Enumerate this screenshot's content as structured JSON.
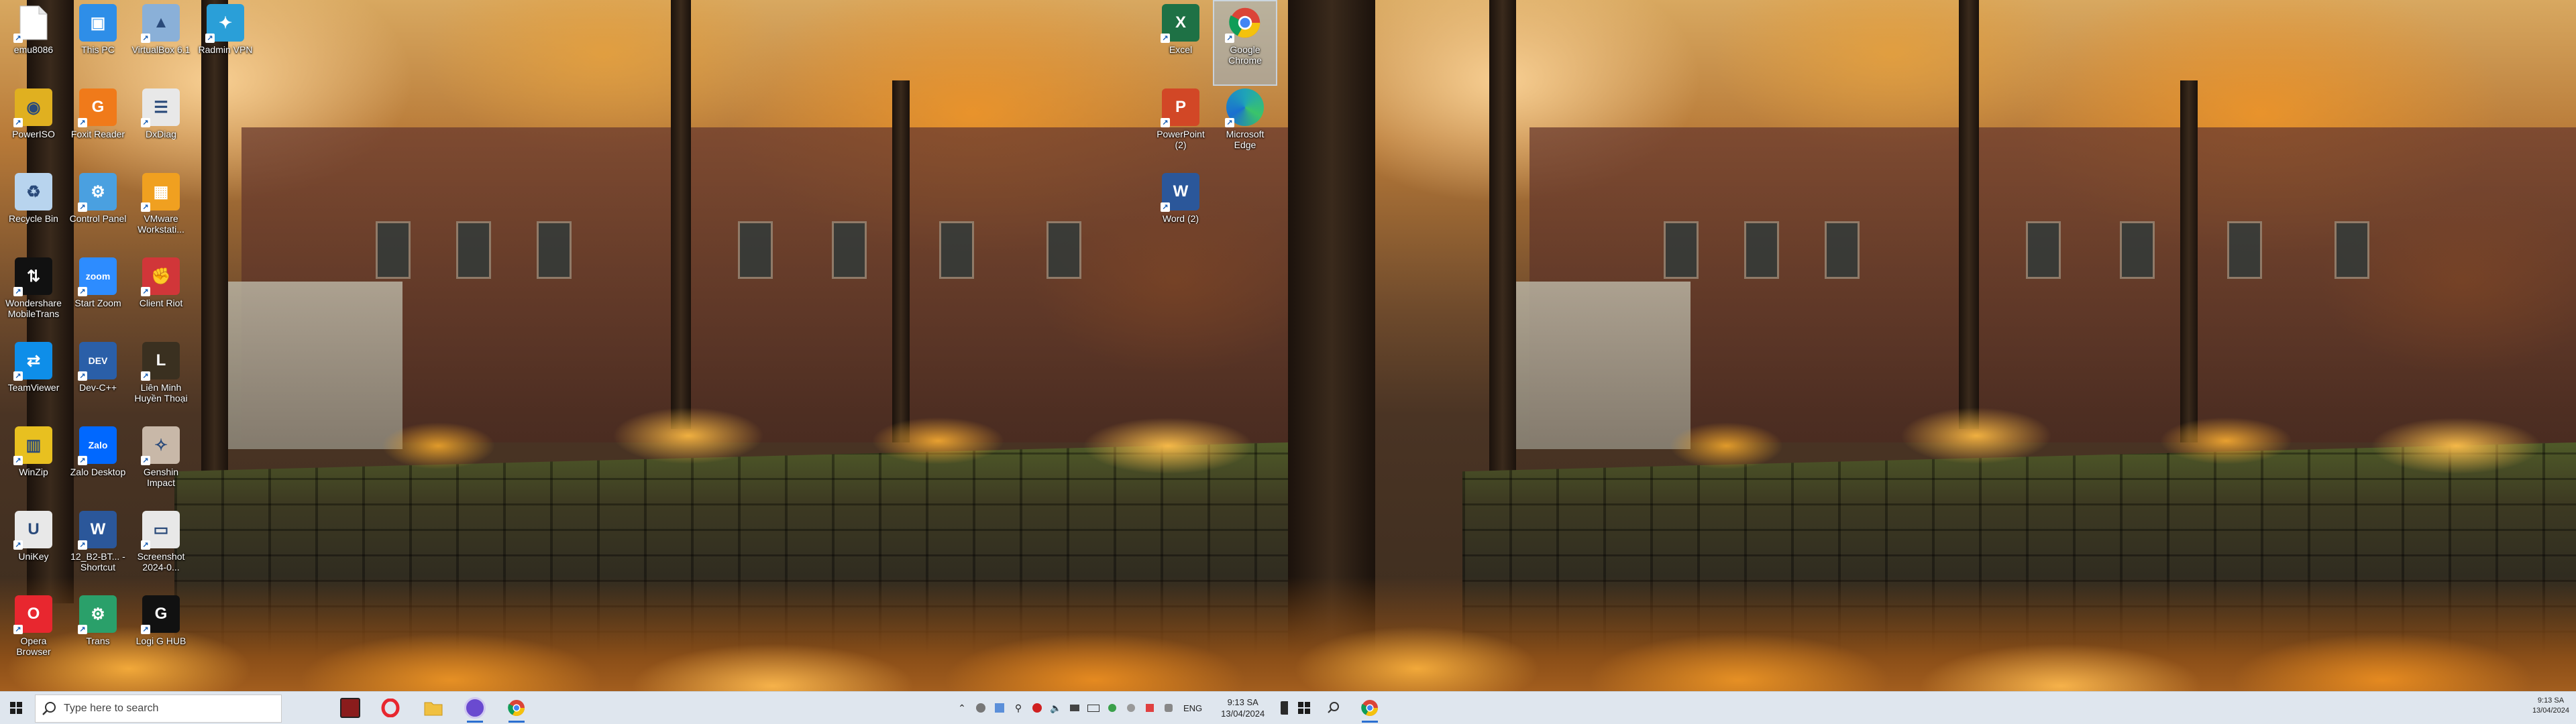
{
  "left_monitor": {
    "desktop_icons": [
      {
        "label": "emu8086",
        "icon": "file-icon",
        "color": "#ffffff"
      },
      {
        "label": "This PC",
        "icon": "computer-icon",
        "color": "#2e8ee8"
      },
      {
        "label": "VirtualBox 6.1",
        "icon": "virtualbox-icon",
        "color": "#8ab0d8"
      },
      {
        "label": "Radmin VPN",
        "icon": "radmin-vpn-icon",
        "color": "#2a9fd8"
      },
      {
        "label": "PowerISO",
        "icon": "poweriso-icon",
        "color": "#e0b020"
      },
      {
        "label": "Foxit Reader",
        "icon": "foxit-icon",
        "color": "#f07a1a"
      },
      {
        "label": "DxDiag",
        "icon": "dxdiag-icon",
        "color": "#e8e8e8"
      },
      {
        "label": "Recycle Bin",
        "icon": "recycle-bin-icon",
        "color": "#b8d4ee"
      },
      {
        "label": "Control Panel",
        "icon": "control-panel-icon",
        "color": "#4aa0e0"
      },
      {
        "label": "VMware Workstati...",
        "icon": "vmware-icon",
        "color": "#f0a020"
      },
      {
        "label": "Wondershare MobileTrans",
        "icon": "mobiletrans-icon",
        "color": "#111111"
      },
      {
        "label": "Start Zoom",
        "icon": "zoom-icon",
        "color": "#2d8cff"
      },
      {
        "label": "Client Riot",
        "icon": "riot-icon",
        "color": "#d13639"
      },
      {
        "label": "TeamViewer",
        "icon": "teamviewer-icon",
        "color": "#0e8ee9"
      },
      {
        "label": "Dev-C++",
        "icon": "devcpp-icon",
        "color": "#2a5fa8"
      },
      {
        "label": "Liên Minh Huyền Thoại",
        "icon": "league-icon",
        "color": "#3a3020"
      },
      {
        "label": "WinZip",
        "icon": "winzip-icon",
        "color": "#e8c020"
      },
      {
        "label": "Zalo Desktop",
        "icon": "zalo-icon",
        "color": "#0068ff"
      },
      {
        "label": "Genshin Impact",
        "icon": "genshin-icon",
        "color": "#c8b8a8"
      },
      {
        "label": "UniKey",
        "icon": "unikey-icon",
        "color": "#e8e8e8"
      },
      {
        "label": "12_B2-BT... - Shortcut",
        "icon": "word-doc-icon",
        "color": "#2b579a"
      },
      {
        "label": "Screenshot 2024-0...",
        "icon": "image-file-icon",
        "color": "#e8e8e8"
      },
      {
        "label": "Opera Browser",
        "icon": "opera-icon",
        "color": "#e8272f"
      },
      {
        "label": "Trans",
        "icon": "trans-icon",
        "color": "#2aa06a"
      },
      {
        "label": "Logi G HUB",
        "icon": "ghub-icon",
        "color": "#111111"
      },
      {
        "label": "Excel",
        "icon": "excel-icon",
        "color": "#1e7145"
      },
      {
        "label": "Google Chrome",
        "icon": "chrome-icon",
        "color": "#ffffff"
      },
      {
        "label": "PowerPoint (2)",
        "icon": "powerpoint-icon",
        "color": "#d24726"
      },
      {
        "label": "Microsoft Edge",
        "icon": "edge-icon",
        "color": "#1fa3b8"
      },
      {
        "label": "Word (2)",
        "icon": "word-icon",
        "color": "#2b579a"
      }
    ],
    "taskbar": {
      "search_placeholder": "Type here to search",
      "pinned_apps": [
        {
          "name": "app-icon-1",
          "color": "#8a1c1c"
        },
        {
          "name": "opera-taskbar-icon",
          "color": "#e8272f"
        },
        {
          "name": "file-explorer-icon",
          "color": "#f0c040"
        },
        {
          "name": "app-icon-purple",
          "color": "#6a4ad0"
        },
        {
          "name": "chrome-taskbar-icon",
          "color": "#ffffff"
        }
      ],
      "language": "ENG",
      "time": "9:13 SA",
      "date": "13/04/2024"
    }
  },
  "right_monitor": {
    "taskbar": {
      "time": "9:13 SA",
      "date": "13/04/2024"
    }
  }
}
